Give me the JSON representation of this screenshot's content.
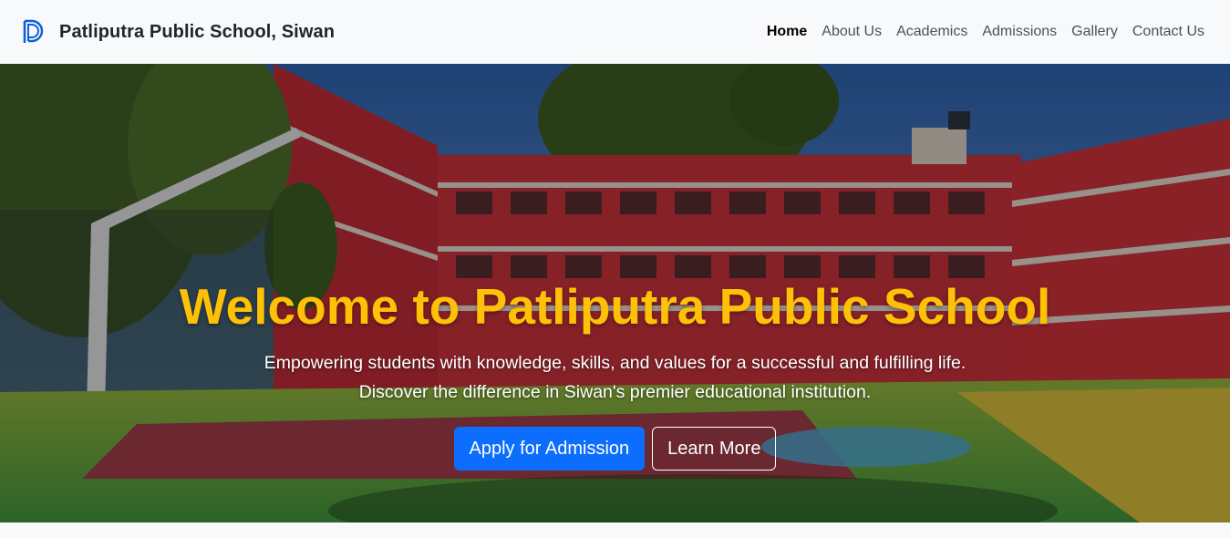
{
  "navbar": {
    "brand_name": "Patliputra Public School, Siwan",
    "links": [
      {
        "label": "Home",
        "active": true
      },
      {
        "label": "About Us"
      },
      {
        "label": "Academics"
      },
      {
        "label": "Admissions"
      },
      {
        "label": "Gallery"
      },
      {
        "label": "Contact Us"
      }
    ]
  },
  "hero": {
    "title": "Welcome to Patliputra Public School",
    "subtitle": "Empowering students with knowledge, skills, and values for a successful and fulfilling life. Discover the difference in Siwan's premier educational institution.",
    "primary_button": "Apply for Admission",
    "secondary_button": "Learn More"
  },
  "colors": {
    "title_accent": "#ffc107",
    "primary_button": "#0d6efd",
    "navbar_bg": "#f8f9fa"
  },
  "icons": {
    "brand_logo": "school-logo-icon"
  }
}
